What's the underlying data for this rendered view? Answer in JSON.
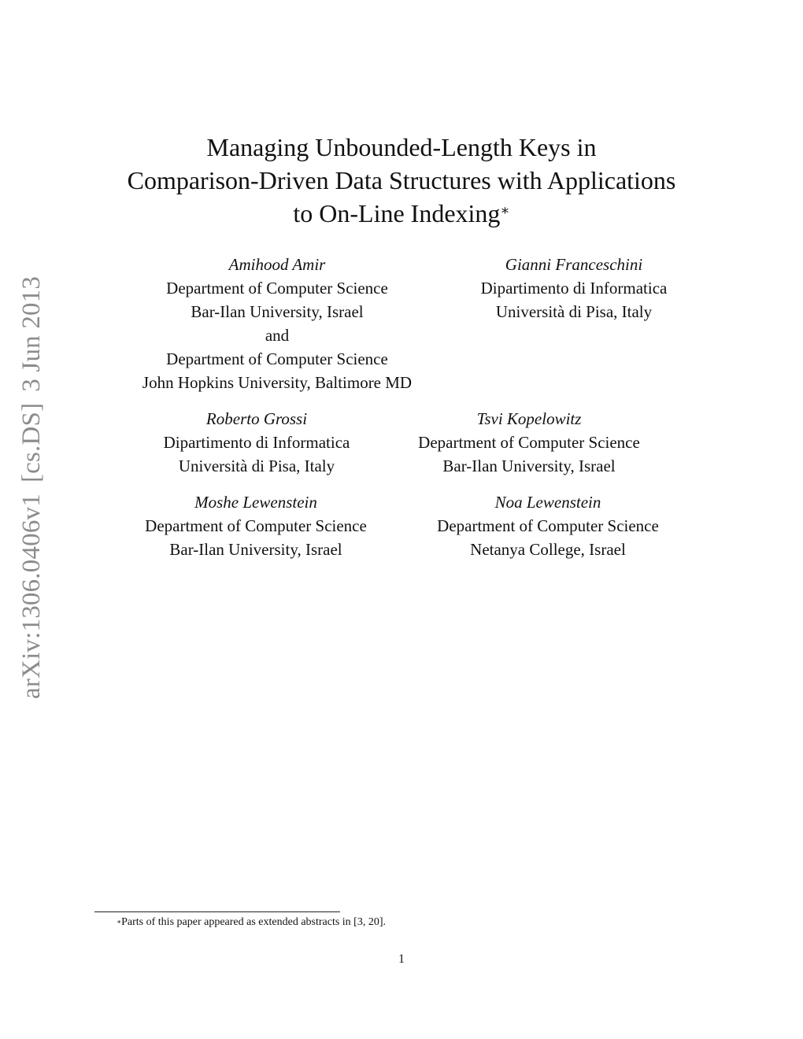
{
  "arxiv_stamp": {
    "id": "arXiv:1306.0406v1",
    "category": "[cs.DS]",
    "date": "3 Jun 2013"
  },
  "title": {
    "lines": [
      "Managing Unbounded-Length Keys in",
      "Comparison-Driven Data Structures with Applications",
      "to On-Line Indexing"
    ],
    "footnote_mark": "∗"
  },
  "authors": [
    {
      "name": "Amihood Amir",
      "affiliation": [
        "Department of Computer Science",
        "Bar-Ilan University, Israel",
        "and",
        "Department of Computer Science",
        "John Hopkins University, Baltimore MD"
      ]
    },
    {
      "name": "Gianni Franceschini",
      "affiliation": [
        "Dipartimento di Informatica",
        "Università di Pisa, Italy"
      ]
    },
    {
      "name": "Roberto Grossi",
      "affiliation": [
        "Dipartimento di Informatica",
        "Università di Pisa, Italy"
      ]
    },
    {
      "name": "Tsvi Kopelowitz",
      "affiliation": [
        "Department of Computer Science",
        "Bar-Ilan University, Israel"
      ]
    },
    {
      "name": "Moshe Lewenstein",
      "affiliation": [
        "Department of Computer Science",
        "Bar-Ilan University, Israel"
      ]
    },
    {
      "name": "Noa Lewenstein",
      "affiliation": [
        "Department of Computer Science",
        "Netanya College, Israel"
      ]
    }
  ],
  "footnote": {
    "mark": "∗",
    "text": "Parts of this paper appeared as extended abstracts in [3, 20]."
  },
  "page_number": "1"
}
